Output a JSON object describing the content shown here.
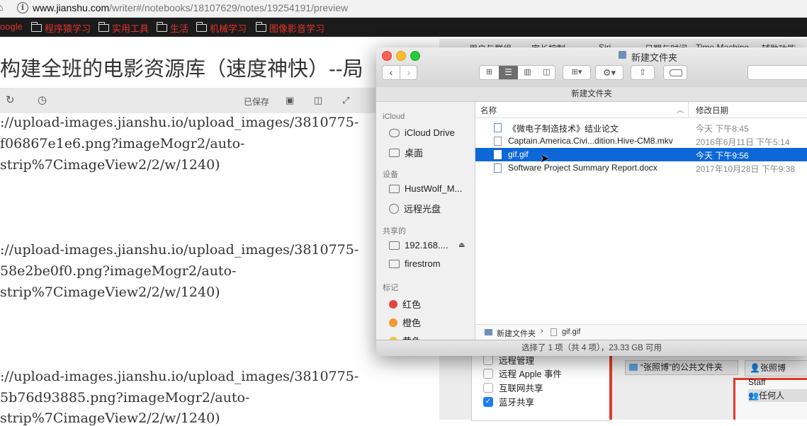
{
  "browser": {
    "url_domain": "www.jianshu.com",
    "url_path": "/writer#/notebooks/18107629/notes/19254191/preview",
    "bookmarks": [
      {
        "label": "oogle"
      },
      {
        "label": "程序猿学习"
      },
      {
        "label": "实用工具"
      },
      {
        "label": "生活"
      },
      {
        "label": "机械学习"
      },
      {
        "label": "图像影音学习"
      }
    ]
  },
  "editor": {
    "title": "构建全班的电影资源库（速度神快）--局",
    "saved_label": "已保存",
    "lines": [
      "://upload-images.jianshu.io/upload_images/3810775-",
      "f06867e1e6.png?imageMogr2/auto-",
      "strip%7CimageView2/2/w/1240)",
      "://upload-images.jianshu.io/upload_images/3810775-",
      "58e2be0f0.png?imageMogr2/auto-",
      "strip%7CimageView2/2/w/1240)",
      "://upload-images.jianshu.io/upload_images/3810775-",
      "5b76d93885.png?imageMogr2/auto-",
      "strip%7CimageView2/2/w/1240)"
    ]
  },
  "prefs": {
    "tabs": [
      "用户与群组",
      "家长控制",
      "Siri",
      "日期与时间",
      "Time Machine",
      "辅助功能"
    ],
    "services": [
      {
        "label": "远程管理",
        "checked": false
      },
      {
        "label": "远程 Apple 事件",
        "checked": false
      },
      {
        "label": "互联网共享",
        "checked": false
      },
      {
        "label": "蓝牙共享",
        "checked": true
      }
    ],
    "shared_folder": "“张照博”的公共文件夹",
    "users": [
      "张照博",
      "Staff",
      "任何人"
    ]
  },
  "finder": {
    "title": "新建文件夹",
    "path_title": "新建文件夹",
    "sidebar": {
      "icloud_header": "iCloud",
      "icloud_drive": "iCloud Drive",
      "desktop": "桌面",
      "devices_header": "设备",
      "device_mac": "HustWolf_M...",
      "remote_disc": "远程光盘",
      "shared_header": "共享的",
      "shared_ip": "192.168....",
      "shared_firestrom": "firestrom",
      "tags_header": "标记",
      "tags": [
        {
          "label": "红色",
          "color": "#e5463b"
        },
        {
          "label": "橙色",
          "color": "#f19a2e"
        },
        {
          "label": "黄色",
          "color": "#f3c533"
        }
      ]
    },
    "columns": {
      "name": "名称",
      "date": "修改日期"
    },
    "files": [
      {
        "name": "《微电子制造技术》结业论文",
        "date": "今天 下午8:45",
        "selected": false
      },
      {
        "name": "Captain.America.Civi...dition.Hive-CM8.mkv",
        "date": "2016年6月11日 下午5:14",
        "selected": false
      },
      {
        "name": "gif.gif",
        "date": "今天 下午9:56",
        "selected": true
      },
      {
        "name": "Software Project Summary Report.docx",
        "date": "2017年10月28日 下午9:38",
        "selected": false
      }
    ],
    "pathbar": {
      "folder": "新建文件夹",
      "separator": "›",
      "file": "gif.gif"
    },
    "status": "选择了 1 项（共 4 项），23.33 GB 可用"
  }
}
